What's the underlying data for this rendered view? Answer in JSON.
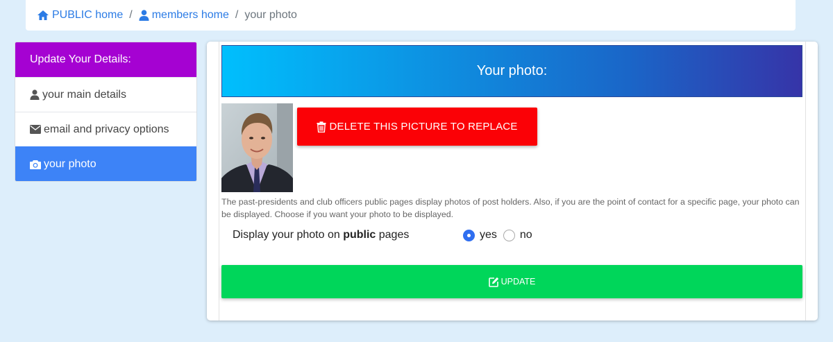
{
  "breadcrumb": {
    "items": [
      {
        "label": "PUBLIC home",
        "icon": "home-icon"
      },
      {
        "label": "members home",
        "icon": "user-icon"
      },
      {
        "label": "your photo"
      }
    ],
    "separator": "/"
  },
  "sidebar": {
    "heading": "Update Your Details:",
    "items": [
      {
        "label": "your main details",
        "icon": "user-icon"
      },
      {
        "label": "email and privacy options",
        "icon": "envelope-icon"
      },
      {
        "label": "your photo",
        "icon": "camera-icon",
        "active": true
      }
    ]
  },
  "main": {
    "title": "Your photo:",
    "delete_label": "DELETE THIS PICTURE TO REPLACE",
    "help_text": "The past-presidents and club officers public pages display photos of post holders. Also, if you are the point of contact for a specific page, your photo can be displayed. Choose if you want your photo to be displayed.",
    "display_prefix": "Display your photo on ",
    "display_bold": "public",
    "display_suffix": " pages",
    "options": [
      {
        "label": "yes",
        "checked": true
      },
      {
        "label": "no",
        "checked": false
      }
    ],
    "update_label": "UPDATE"
  },
  "colors": {
    "sidebar_head": "#a502d2",
    "sidebar_active": "#3d83f7",
    "delete_button": "#fb0106",
    "update_button": "#00d65a",
    "link": "#2b7be5"
  }
}
